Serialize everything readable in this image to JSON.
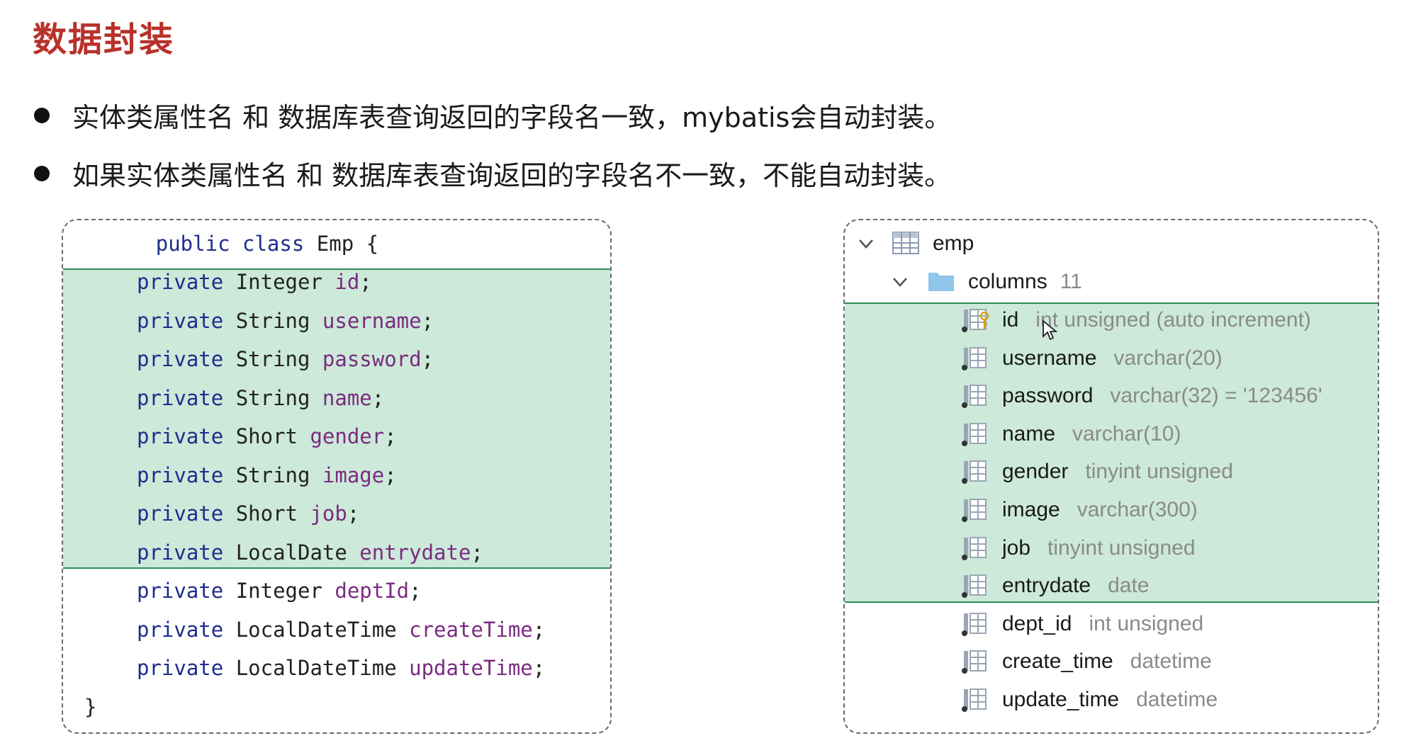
{
  "title": "数据封装",
  "bullets": [
    "实体类属性名 和 数据库表查询返回的字段名一致，mybatis会自动封装。",
    "如果实体类属性名 和 数据库表查询返回的字段名不一致，不能自动封装。"
  ],
  "code": {
    "header": {
      "kw1": "public",
      "kw2": "class",
      "cls": "Emp",
      "brace": "{"
    },
    "fields": [
      {
        "mod": "private",
        "type": "Integer",
        "name": "id"
      },
      {
        "mod": "private",
        "type": "String",
        "name": "username"
      },
      {
        "mod": "private",
        "type": "String",
        "name": "password"
      },
      {
        "mod": "private",
        "type": "String",
        "name": "name"
      },
      {
        "mod": "private",
        "type": "Short",
        "name": "gender"
      },
      {
        "mod": "private",
        "type": "String",
        "name": "image"
      },
      {
        "mod": "private",
        "type": "Short",
        "name": "job"
      },
      {
        "mod": "private",
        "type": "LocalDate",
        "name": "entrydate"
      },
      {
        "mod": "private",
        "type": "Integer",
        "name": "deptId"
      },
      {
        "mod": "private",
        "type": "LocalDateTime",
        "name": "createTime"
      },
      {
        "mod": "private",
        "type": "LocalDateTime",
        "name": "updateTime"
      }
    ],
    "semicolon": ";",
    "footer": "}"
  },
  "db": {
    "table": "emp",
    "folder": "columns",
    "count": "11",
    "columns": [
      {
        "name": "id",
        "type": "int unsigned (auto increment)",
        "icon": "primary-key-column-icon"
      },
      {
        "name": "username",
        "type": "varchar(20)",
        "icon": "column-icon"
      },
      {
        "name": "password",
        "type": "varchar(32) = '123456'",
        "icon": "column-icon"
      },
      {
        "name": "name",
        "type": "varchar(10)",
        "icon": "column-icon"
      },
      {
        "name": "gender",
        "type": "tinyint unsigned",
        "icon": "column-icon"
      },
      {
        "name": "image",
        "type": "varchar(300)",
        "icon": "column-icon"
      },
      {
        "name": "job",
        "type": "tinyint unsigned",
        "icon": "column-icon"
      },
      {
        "name": "entrydate",
        "type": "date",
        "icon": "column-icon"
      },
      {
        "name": "dept_id",
        "type": "int unsigned",
        "icon": "column-icon"
      },
      {
        "name": "create_time",
        "type": "datetime",
        "icon": "column-icon"
      },
      {
        "name": "update_time",
        "type": "datetime",
        "icon": "column-icon"
      }
    ]
  },
  "colors": {
    "title": "#b8312a",
    "highlight_fill": "#cce9d9",
    "highlight_border": "#2e8b57",
    "keyword": "#1f2d8c",
    "field_name": "#7a2b80",
    "type_gray": "#8a8a8a"
  }
}
